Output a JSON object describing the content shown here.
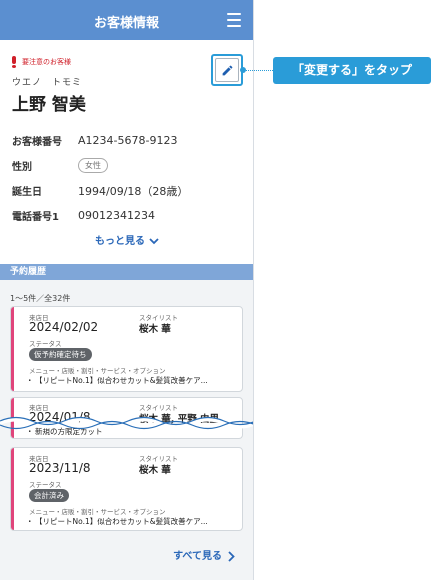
{
  "header": {
    "title": "お客様情報"
  },
  "alert": {
    "text": "要注意のお客様"
  },
  "customer": {
    "kana": "ウエノ　トモミ",
    "name": "上野 智美"
  },
  "info": {
    "rows": [
      {
        "label": "お客様番号",
        "value": "A1234-5678-9123"
      },
      {
        "label": "性別",
        "value": "女性"
      },
      {
        "label": "誕生日",
        "value": "1994/09/18（28歳）"
      },
      {
        "label": "電話番号1",
        "value": "09012341234"
      }
    ]
  },
  "more_label": "もっと見る",
  "reservations": {
    "section_title": "予約履歴",
    "count": "1〜5件／全32件",
    "labels": {
      "visit_date": "来店日",
      "stylist": "スタイリスト",
      "status": "ステータス",
      "menu": "メニュー・店販・割引・サービス・オプション"
    },
    "cards": [
      {
        "date": "2024/02/02",
        "stylist": "桜木 華",
        "status": "仮予約確定待ち",
        "menu": "【リピートNo.1】似合わせカット&髪質改善ケア..."
      },
      {
        "date": "2024/01/8",
        "stylist": "桜木 華, 平野 由里",
        "menu": "新規の方限定カット"
      },
      {
        "date": "2023/11/8",
        "stylist": "桜木 華",
        "status": "会計済み",
        "menu": "【リピートNo.1】似合わせカット&髪質改善ケア..."
      }
    ],
    "see_all": "すべて見る"
  },
  "callout": {
    "text": "「変更する」をタップ"
  },
  "colors": {
    "header": "#5b8fd0",
    "accent": "#2a9cd8",
    "alert": "#d0202a",
    "card_bar": "#e0457b"
  }
}
